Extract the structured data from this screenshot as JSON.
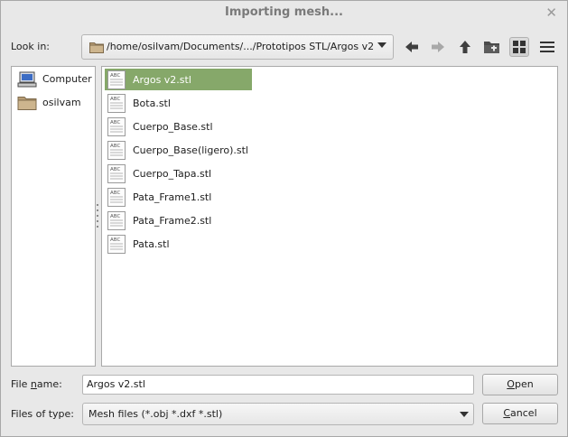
{
  "window": {
    "title": "Importing mesh..."
  },
  "toolbar": {
    "look_in_label": "Look in:",
    "path": "/home/osilvam/Documents/.../Prototipos STL/Argos v2"
  },
  "places": [
    {
      "label": "Computer",
      "icon": "computer-icon"
    },
    {
      "label": "osilvam",
      "icon": "folder-icon"
    }
  ],
  "files": [
    {
      "name": "Argos v2.stl",
      "selected": true
    },
    {
      "name": "Bota.stl",
      "selected": false
    },
    {
      "name": "Cuerpo_Base.stl",
      "selected": false
    },
    {
      "name": "Cuerpo_Base(ligero).stl",
      "selected": false
    },
    {
      "name": "Cuerpo_Tapa.stl",
      "selected": false
    },
    {
      "name": "Pata_Frame1.stl",
      "selected": false
    },
    {
      "name": "Pata_Frame2.stl",
      "selected": false
    },
    {
      "name": "Pata.stl",
      "selected": false
    }
  ],
  "footer": {
    "file_name_label_pre": "File ",
    "file_name_label_mn": "n",
    "file_name_label_post": "ame:",
    "file_name_value": "Argos v2.stl",
    "files_of_type_label": "Files of type:",
    "files_of_type_value": "Mesh files (*.obj *.dxf *.stl)",
    "open_mn": "O",
    "open_rest": "pen",
    "cancel_mn": "C",
    "cancel_rest": "ancel"
  },
  "colors": {
    "selection": "#86a86a",
    "title_text": "#7a7a7a"
  }
}
